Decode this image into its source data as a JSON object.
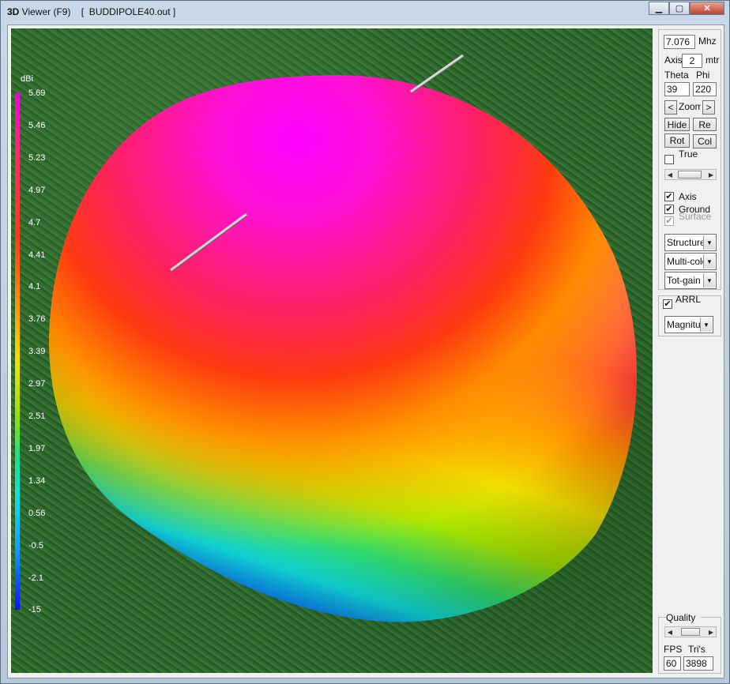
{
  "window": {
    "title_prefix": "3D",
    "title_rest": " Viewer (F9)    [  BUDDIPOLE40.out ]",
    "minimize": "▁",
    "maximize": "▢",
    "close": "✕"
  },
  "legend": {
    "unit": "dBi",
    "ticks": [
      "5.69",
      "5.46",
      "5.23",
      "4.97",
      "4.7",
      "4.41",
      "4.1",
      "3.76",
      "3.39",
      "2.97",
      "2.51",
      "1.97",
      "1.34",
      "0.56",
      "-0.5",
      "-2.1",
      "-15"
    ]
  },
  "panel": {
    "freq": "7.076",
    "freq_unit": "Mhz",
    "axis_label": "Axis",
    "axis_value": "2",
    "axis_unit": "mtr",
    "theta_label": "Theta",
    "phi_label": "Phi",
    "theta": "39",
    "phi": "220",
    "zoom_left": "<",
    "zoom_label": "Zoom",
    "zoom_right": ">",
    "hide_btn": "Hide",
    "re_btn": "Re",
    "rot_btn": "Rot",
    "col_btn": "Col",
    "true_label": "True",
    "axis_chk": "Axis",
    "ground_chk": "Ground",
    "surface_chk": "Surface",
    "select_structure": "Structure",
    "select_multi": "Multi-color",
    "select_totgain": "Tot-gain",
    "arrl_label": "ARRL",
    "select_magnitude": "Magnitude",
    "quality_label": "Quality",
    "fps_label": "FPS",
    "tris_label": "Tri's",
    "fps": "60",
    "tris": "3898"
  },
  "colors": {
    "max": "#f000e0",
    "mid": "#f5e000",
    "min": "#1010ff"
  }
}
